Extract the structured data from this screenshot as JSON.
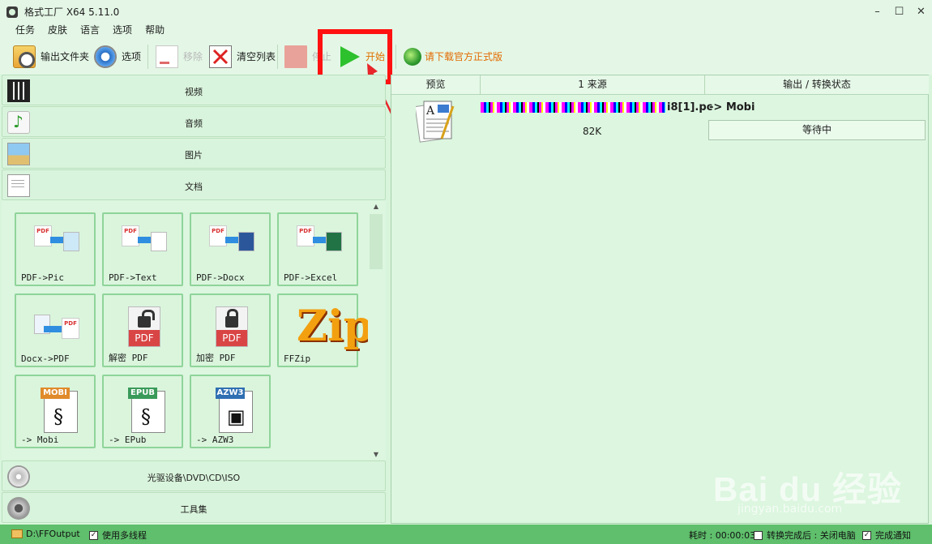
{
  "window": {
    "title": "格式工厂 X64 5.11.0",
    "min": "–",
    "max": "☐",
    "close": "✕"
  },
  "menu": [
    "任务",
    "皮肤",
    "语言",
    "选项",
    "帮助"
  ],
  "toolbar": {
    "output_folder": "输出文件夹",
    "options": "选项",
    "remove": "移除",
    "clear_list": "清空列表",
    "stop": "停止",
    "start": "开始",
    "download": "请下载官方正式版"
  },
  "categories": {
    "video": "视频",
    "audio": "音频",
    "image": "图片",
    "document": "文档",
    "disc": "光驱设备\\DVD\\CD\\ISO",
    "tools": "工具集"
  },
  "doc_tools": [
    {
      "label": "PDF->Pic"
    },
    {
      "label": "PDF->Text"
    },
    {
      "label": "PDF->Docx"
    },
    {
      "label": "PDF->Excel"
    },
    {
      "label": "Docx->PDF"
    },
    {
      "label": "解密 PDF"
    },
    {
      "label": "加密 PDF"
    },
    {
      "label": "FFZip"
    },
    {
      "label": "-> Mobi",
      "tag": "MOBI"
    },
    {
      "label": "-> EPub",
      "tag": "EPUB"
    },
    {
      "label": "-> AZW3",
      "tag": "AZW3"
    }
  ],
  "task_table": {
    "headers": {
      "preview": "预览",
      "source": "1 来源",
      "status": "输出 / 转换状态"
    },
    "row": {
      "source_suffix": "i8[1].pc",
      "size": "82K",
      "target": "-> Mobi",
      "status": "等待中"
    }
  },
  "statusbar": {
    "output_path": "D:\\FFOutput",
    "multithread": "使用多线程",
    "elapsed": "耗时 : 00:00:03",
    "after_done": "转换完成后 : 关闭电脑",
    "notify": "完成通知"
  },
  "watermark": {
    "main": "Bai du 经验",
    "sub": "jingyan.baidu.com"
  },
  "colors": {
    "accent": "#e07000",
    "start_green": "#2ec12e",
    "highlight_red": "#ff1111",
    "statusbar": "#5fbf6c"
  }
}
